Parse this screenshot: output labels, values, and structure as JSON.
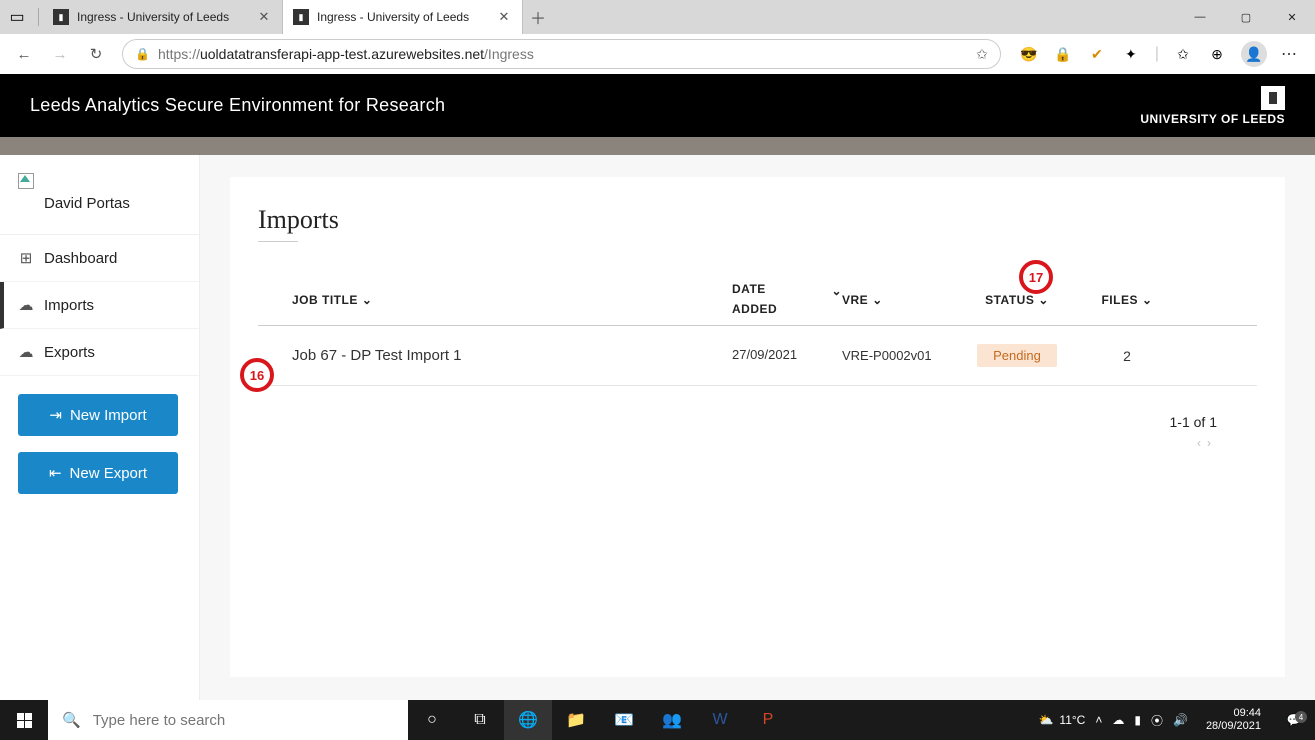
{
  "browser": {
    "tabs": [
      {
        "title": "Ingress - University of Leeds",
        "active": false
      },
      {
        "title": "Ingress - University of Leeds",
        "active": true
      }
    ],
    "url_scheme": "https://",
    "url_host": "uoldatatransferapi-app-test.azurewebsites.net",
    "url_path": "/Ingress"
  },
  "header": {
    "title": "Leeds Analytics Secure Environment for Research",
    "org": "UNIVERSITY OF LEEDS"
  },
  "sidebar": {
    "user_name": "David Portas",
    "items": [
      {
        "label": "Dashboard",
        "icon": "⊞"
      },
      {
        "label": "Imports",
        "icon": "☁",
        "active": true
      },
      {
        "label": "Exports",
        "icon": "☁"
      }
    ],
    "buttons": {
      "new_import": "New Import",
      "new_export": "New Export"
    }
  },
  "page": {
    "title": "Imports",
    "columns": {
      "job_title": "JOB TITLE",
      "date_added_l1": "DATE",
      "date_added_l2": "ADDED",
      "vre": "VRE",
      "status": "STATUS",
      "files": "FILES"
    },
    "rows": [
      {
        "job_title": "Job 67 - DP Test Import 1",
        "date_added": "27/09/2021",
        "vre": "VRE-P0002v01",
        "status": "Pending",
        "files": "2"
      }
    ],
    "pagination": {
      "range": "1-1 of 1"
    }
  },
  "annotations": {
    "a16": "16",
    "a17": "17"
  },
  "taskbar": {
    "search_placeholder": "Type here to search",
    "weather_temp": "11°C",
    "clock_time": "09:44",
    "clock_date": "28/09/2021",
    "notif_count": "4"
  }
}
